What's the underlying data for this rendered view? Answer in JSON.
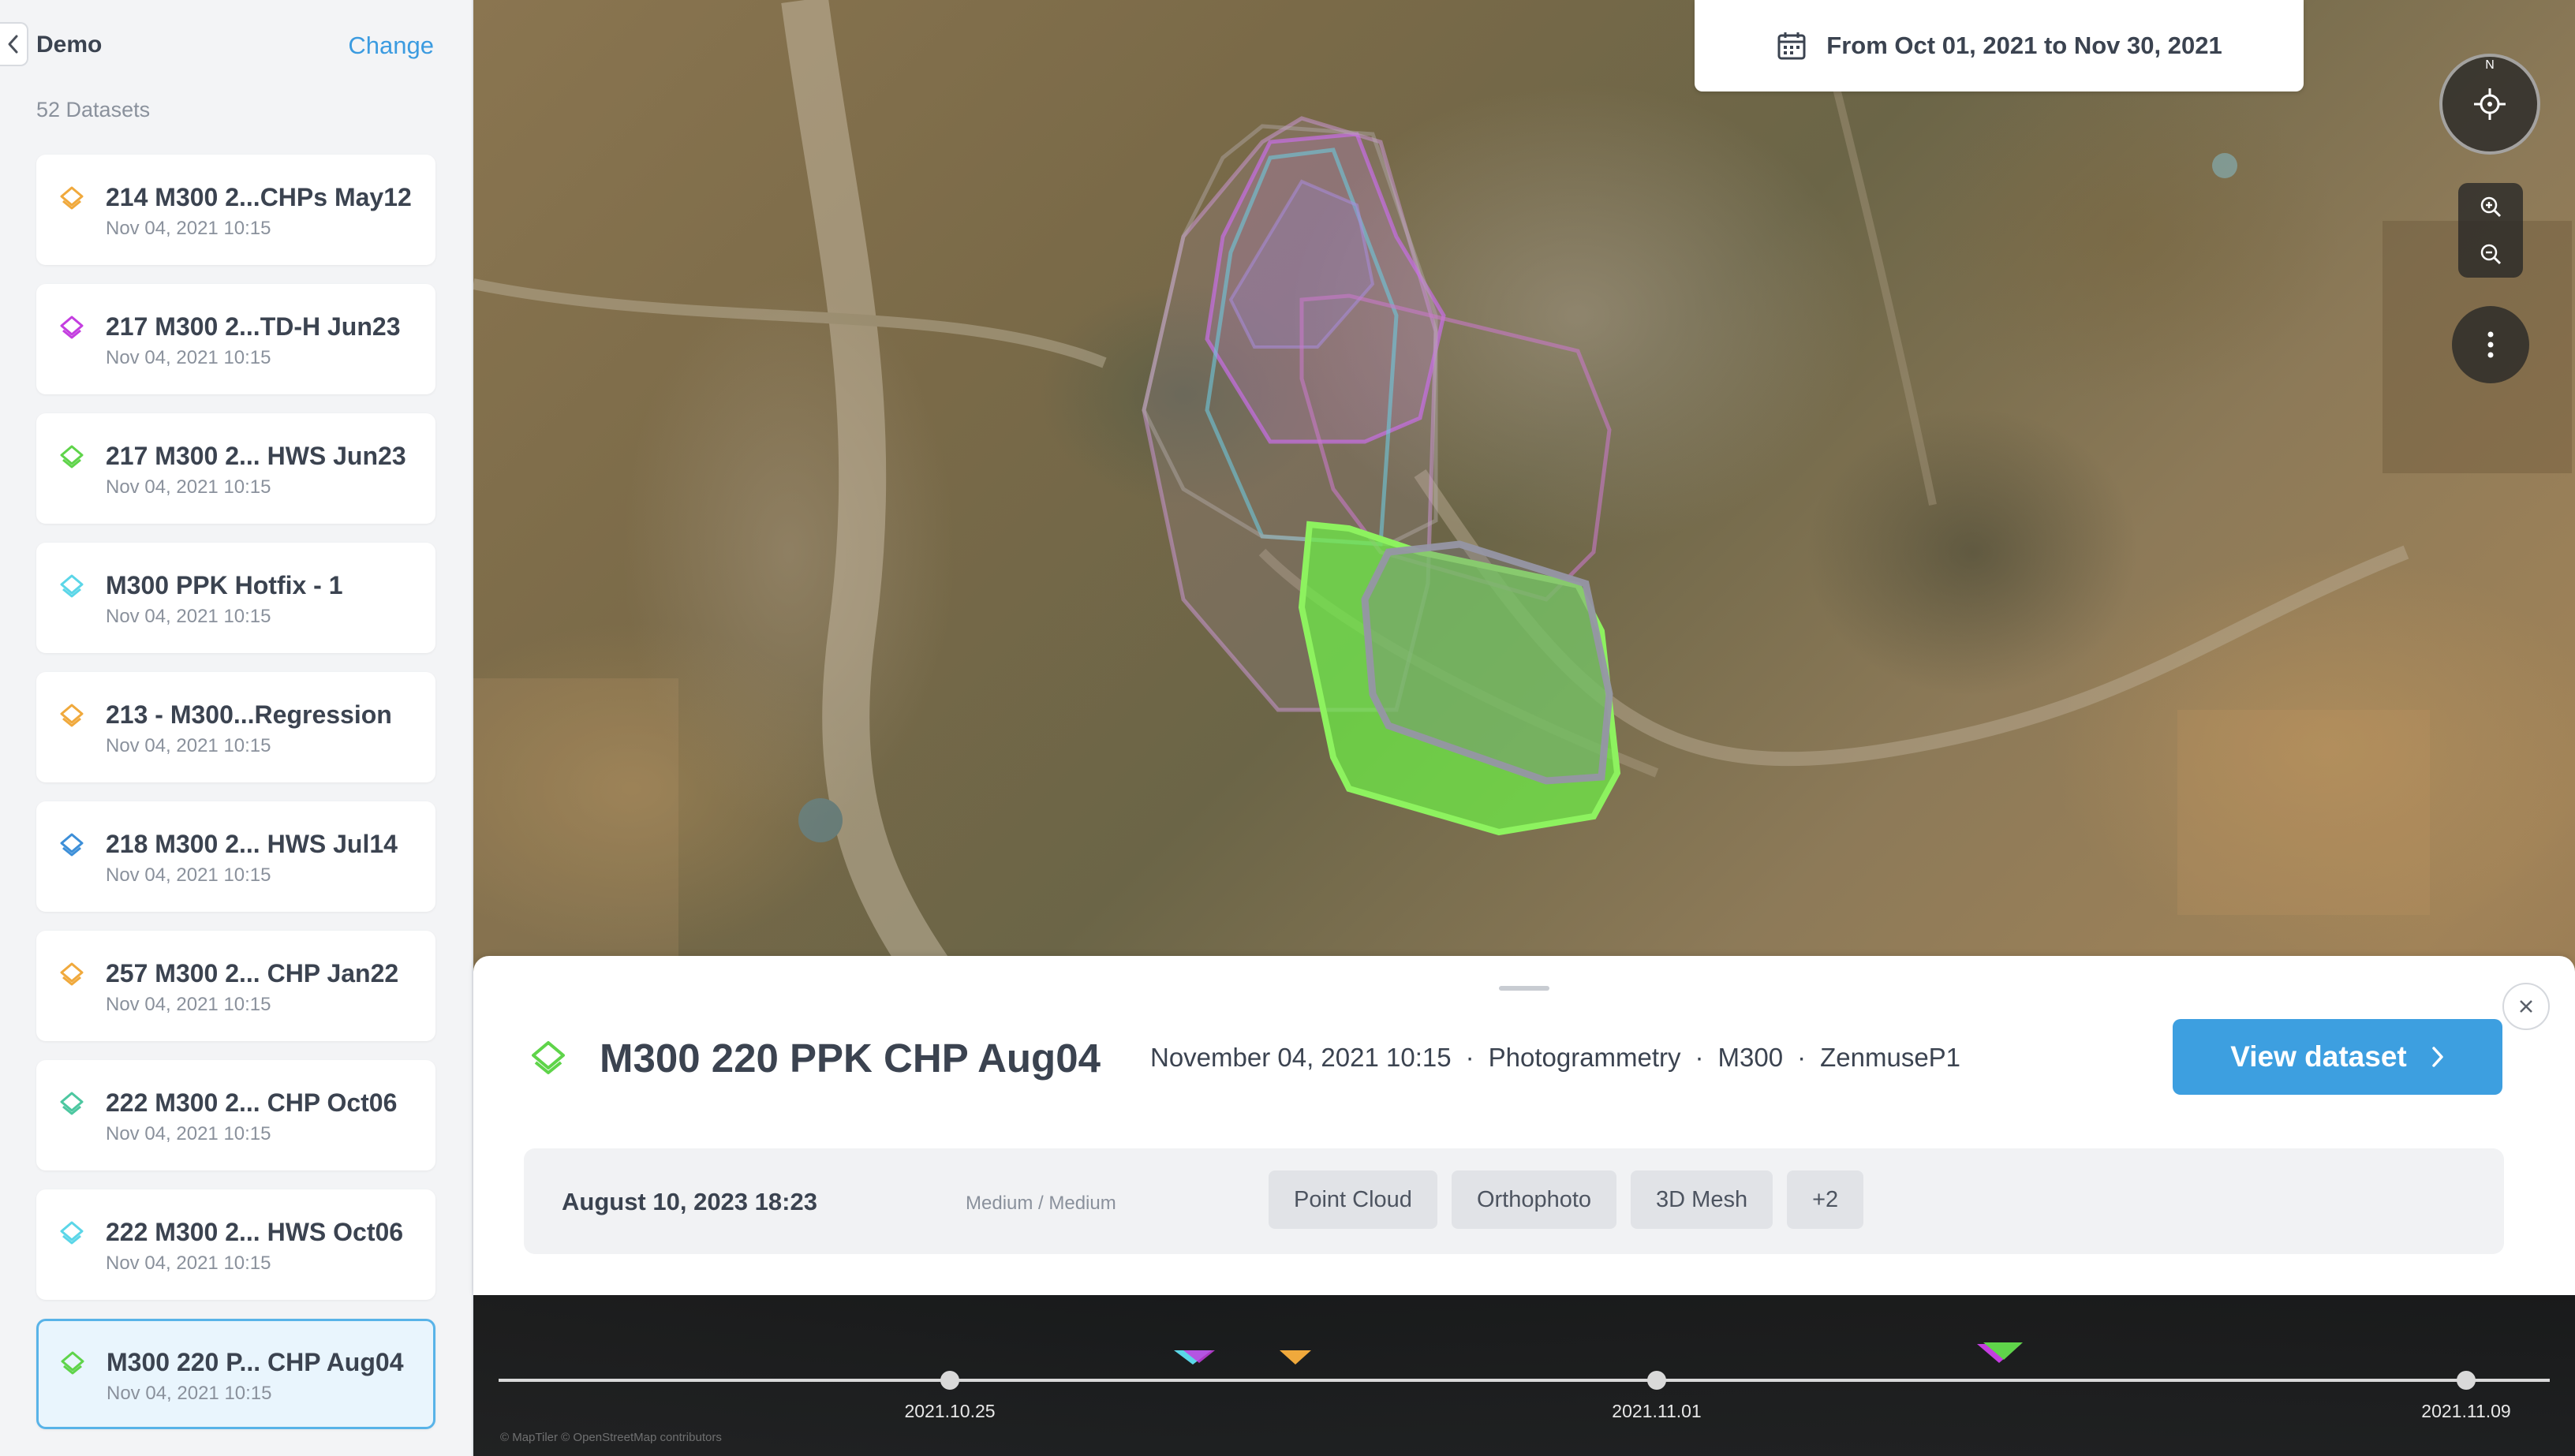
{
  "sidebar": {
    "project_name": "Demo",
    "change_label": "Change",
    "dataset_count": "52 Datasets",
    "datasets": [
      {
        "title": "214 M300 2...CHPs May12",
        "date": "Nov 04, 2021 10:15",
        "icon_color": "#f0a93c"
      },
      {
        "title": "217 M300 2...TD-H Jun23",
        "date": "Nov 04, 2021 10:15",
        "icon_color": "#c43ee0"
      },
      {
        "title": "217 M300 2... HWS Jun23",
        "date": "Nov 04, 2021 10:15",
        "icon_color": "#5fd44a"
      },
      {
        "title": "M300 PPK Hotfix - 1",
        "date": "Nov 04, 2021 10:15",
        "icon_color": "#5bd6e8"
      },
      {
        "title": "213 - M300...Regression",
        "date": "Nov 04, 2021 10:15",
        "icon_color": "#f0a93c"
      },
      {
        "title": "218 M300 2... HWS Jul14",
        "date": "Nov 04, 2021 10:15",
        "icon_color": "#3d8fd8"
      },
      {
        "title": "257 M300 2... CHP Jan22",
        "date": "Nov 04, 2021 10:15",
        "icon_color": "#f0a93c"
      },
      {
        "title": "222 M300 2... CHP Oct06",
        "date": "Nov 04, 2021 10:15",
        "icon_color": "#4cc7a0"
      },
      {
        "title": "222 M300 2... HWS Oct06",
        "date": "Nov 04, 2021 10:15",
        "icon_color": "#5bd6e8"
      },
      {
        "title": "M300 220 P... CHP Aug04",
        "date": "Nov 04, 2021 10:15",
        "icon_color": "#5fd44a",
        "selected": true
      }
    ]
  },
  "map": {
    "date_range_label": "From Oct 01, 2021  to Nov 30, 2021",
    "compass_letter": "N",
    "icons": {
      "calendar": "calendar-icon",
      "locate": "crosshair-icon",
      "zoom_in": "zoom-in-icon",
      "zoom_out": "zoom-out-icon",
      "more": "more-vertical-icon"
    }
  },
  "panel": {
    "title": "M300 220 PPK CHP Aug04",
    "meta": [
      "November 04, 2021 10:15",
      "Photogrammetry",
      "M300",
      "ZenmuseP1"
    ],
    "meta_separator": "·",
    "view_button": "View dataset",
    "version": {
      "date": "August 10, 2023 18:23",
      "quality": "Medium / Medium",
      "tags": [
        "Point Cloud",
        "Orthophoto",
        "3D Mesh",
        "+2"
      ]
    },
    "accent_color": "#5fd44a"
  },
  "timeline": {
    "ticks": [
      "2021.10.25",
      "2021.11.01",
      "2021.11.09"
    ],
    "attribution": "© MapTiler © OpenStreetMap contributors"
  }
}
